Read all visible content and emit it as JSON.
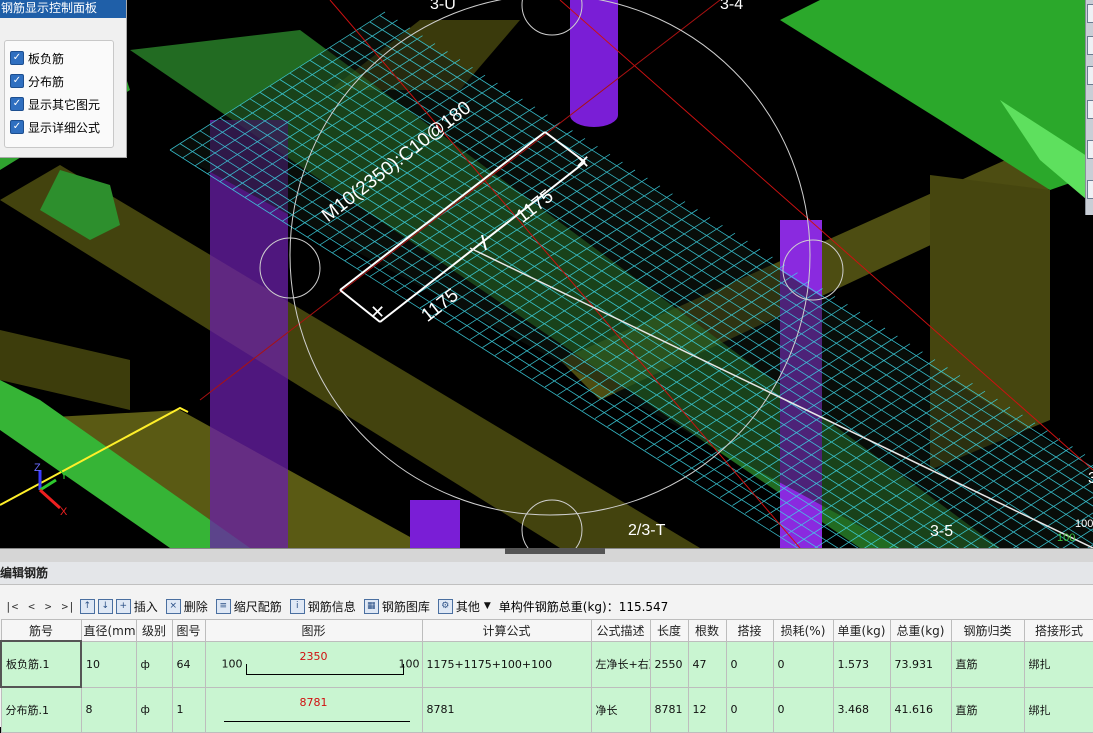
{
  "viewport": {
    "axis_labels": [
      "3-U",
      "3-4",
      "2/3-T",
      "3-5",
      "3"
    ],
    "dimension_texts": {
      "rebar_spec": "M10(2350):C10@180",
      "half_left": "1175",
      "half_right": "1175"
    },
    "corner_texts": [
      "100",
      "100"
    ],
    "axis_gizmo": {
      "z": "Z",
      "y": "Y",
      "x": "X"
    }
  },
  "control_panel": {
    "title": "钢筋显示控制面板",
    "options": [
      {
        "label": "板负筋",
        "checked": true
      },
      {
        "label": "分布筋",
        "checked": true
      },
      {
        "label": "显示其它图元",
        "checked": true
      },
      {
        "label": "显示详细公式",
        "checked": true
      }
    ]
  },
  "edit_panel": {
    "title": "编辑钢筋",
    "nav": [
      "|<",
      "<",
      ">",
      ">|"
    ],
    "toolbar": [
      {
        "label": "插入",
        "icon": "insert-icon"
      },
      {
        "label": "删除",
        "icon": "delete-icon"
      },
      {
        "label": "缩尺配筋",
        "icon": "scale-rebar-icon"
      },
      {
        "label": "钢筋信息",
        "icon": "rebar-info-icon"
      },
      {
        "label": "钢筋图库",
        "icon": "rebar-library-icon"
      },
      {
        "label": "其他",
        "icon": "other-icon"
      }
    ],
    "total_weight_label": "单构件钢筋总重(kg)：115.547",
    "columns": [
      "筋号",
      "直径(mm)",
      "级别",
      "图号",
      "图形",
      "计算公式",
      "公式描述",
      "长度",
      "根数",
      "搭接",
      "损耗(%)",
      "单重(kg)",
      "总重(kg)",
      "钢筋归类",
      "搭接形式"
    ],
    "rows": [
      {
        "index": "1",
        "name": "板负筋.1",
        "diameter": "10",
        "grade": "ф",
        "fig_no": "64",
        "shape_left": "100",
        "shape_value": "2350",
        "shape_right": "100",
        "formula": "1175+1175+100+100",
        "description": "左净长+右净长+…",
        "length": "2550",
        "count": "47",
        "lap": "0",
        "loss": "0",
        "unit_weight": "1.573",
        "total_weight": "73.931",
        "category": "直筋",
        "lap_type": "绑扎"
      },
      {
        "index": "2",
        "name": "分布筋.1",
        "diameter": "8",
        "grade": "ф",
        "fig_no": "1",
        "shape_left": "",
        "shape_value": "8781",
        "shape_right": "",
        "formula": "8781",
        "description": "净长",
        "length": "8781",
        "count": "12",
        "lap": "0",
        "loss": "0",
        "unit_weight": "3.468",
        "total_weight": "41.616",
        "category": "直筋",
        "lap_type": "绑扎"
      }
    ]
  }
}
